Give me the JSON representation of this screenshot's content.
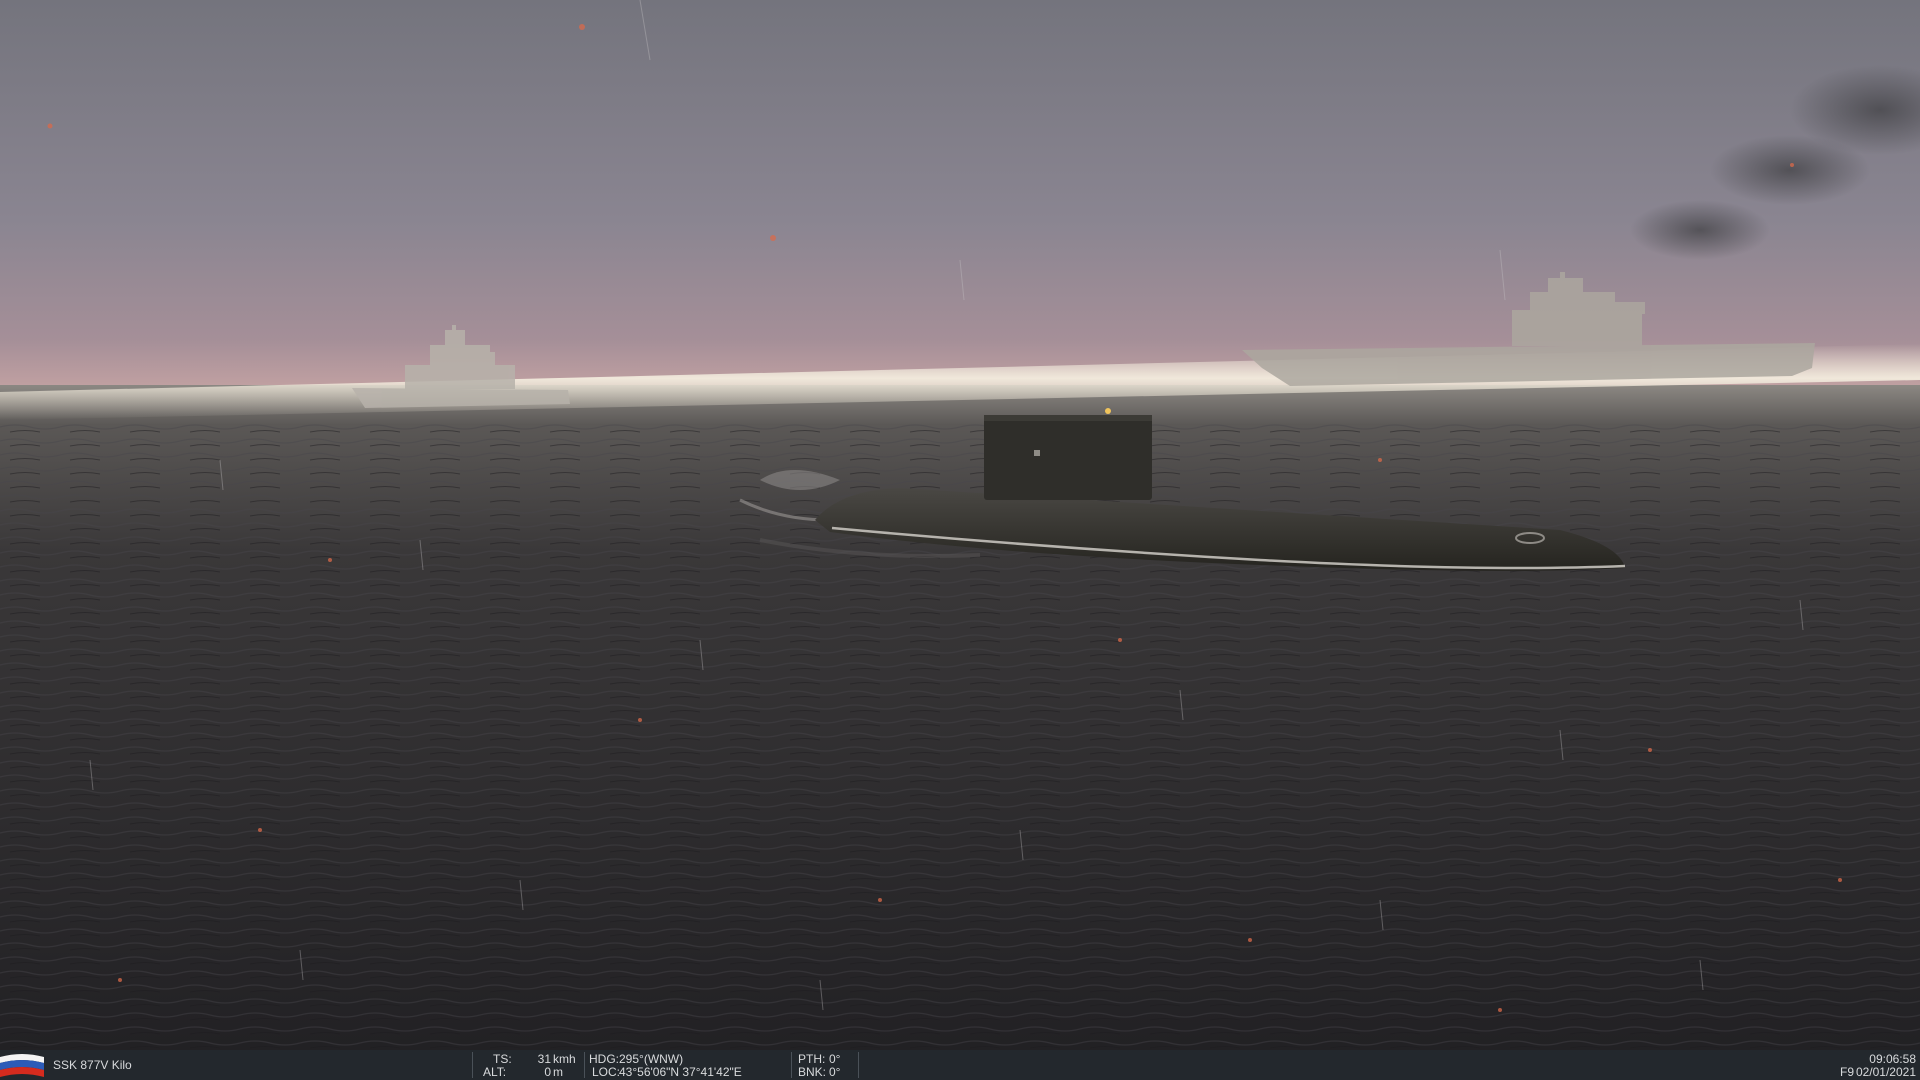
{
  "scene": {
    "description_icons": [
      "flag-russia-icon"
    ],
    "colors": {
      "sky_top": "#77777f",
      "sky_horizon": "#b0969a",
      "sea": "#2b2a2c",
      "haze": "#e8e2d2"
    }
  },
  "hud": {
    "unit_name": "SSK 877V Kilo",
    "ts_label": "TS:",
    "ts_value": "31",
    "ts_unit": "kmh",
    "alt_label": "ALT:",
    "alt_value": "0",
    "alt_unit": "m",
    "hdg_label": "HDG:",
    "hdg_value": "295°(WNW)",
    "loc_label": "LOC:",
    "loc_value": "43°56'06\"N 37°41'42\"E",
    "pth_label": "PTH:",
    "pth_value": "0°",
    "bnk_label": "BNK:",
    "bnk_value": "0°",
    "time": "09:06:58",
    "fkey": "F9",
    "date": "02/01/2021"
  }
}
